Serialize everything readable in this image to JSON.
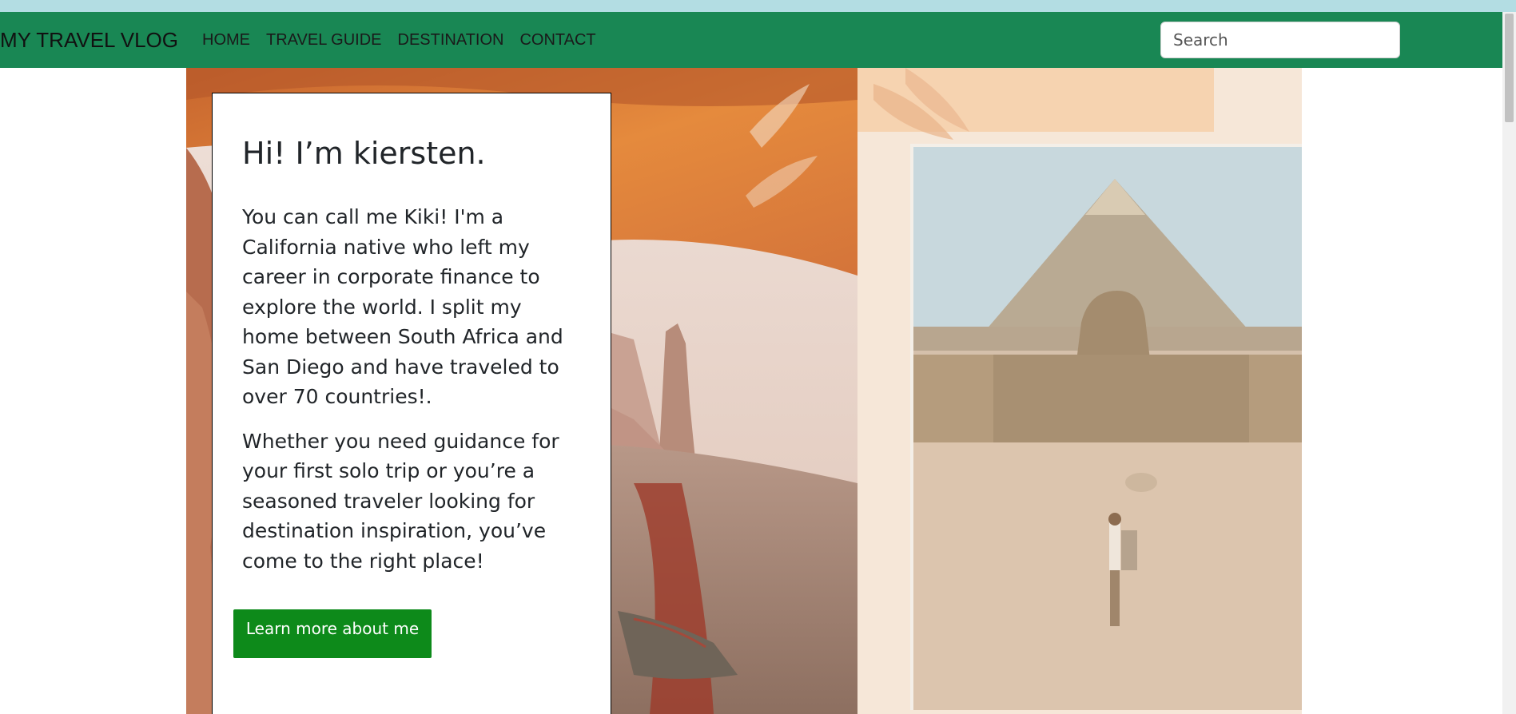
{
  "browser": {
    "tab_strip": ""
  },
  "navbar": {
    "brand": "MY TRAVEL VLOG",
    "links": [
      "HOME",
      "TRAVEL GUIDE",
      "DESTINATION",
      "CONTACT"
    ],
    "search_placeholder": "Search",
    "bg_color": "#198754"
  },
  "intro": {
    "title": "Hi! I’m kiersten.",
    "paragraph1": "You can call me Kiki! I'm a California native who left my career in corporate finance to explore the world. I split my home between South Africa and San Diego and have traveled to over 70 countries!.",
    "paragraph2": "Whether you need guidance for your first solo trip or you’re a seasoned traveler looking for destination inspiration, you’ve come to the right place!",
    "button_label": "Learn more about me",
    "button_color": "#0d8a1a"
  },
  "images": {
    "left": "canyon-arch-with-hiking-boot",
    "right": "pyramid-and-sphinx-with-traveler"
  }
}
